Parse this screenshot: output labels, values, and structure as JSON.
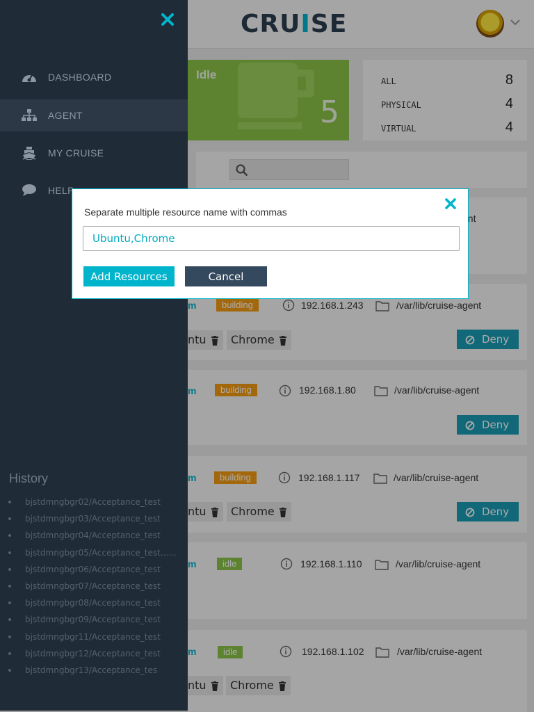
{
  "header": {
    "logo_text_a": "CRU",
    "logo_text_i": "I",
    "logo_text_b": "SE"
  },
  "status_card": {
    "label": "Idle",
    "count": "5",
    "color": "#8bc34a"
  },
  "counts": [
    {
      "label": "ALL",
      "value": "8"
    },
    {
      "label": "PHYSICAL",
      "value": "4"
    },
    {
      "label": "VIRTUAL",
      "value": "4"
    }
  ],
  "sidebar": {
    "items": [
      {
        "label": "DASHBOARD",
        "icon": "dashboard-icon"
      },
      {
        "label": "AGENT",
        "icon": "sitemap-icon",
        "active": true
      },
      {
        "label": "MY CRUISE",
        "icon": "ship-icon"
      },
      {
        "label": "HELP",
        "icon": "comment-icon"
      }
    ],
    "history_title": "History",
    "history": [
      "bjstdmngbgr02/Acceptance_test",
      "bjstdmngbgr03/Acceptance_test",
      "bjstdmngbgr04/Acceptance_test",
      "bjstdmngbgr05/Acceptance_test......",
      "bjstdmngbgr06/Acceptance_test",
      "bjstdmngbgr07/Acceptance_test",
      "bjstdmngbgr08/Acceptance_test",
      "bjstdmngbgr09/Acceptance_test",
      "bjstdmngbgr11/Acceptance_test",
      "bjstdmngbgr12/Acceptance_test",
      "bjstdmngbgr13/Acceptance_tes"
    ]
  },
  "agents": [
    {
      "name_suffix": "m",
      "status": "building",
      "ip": "192.168.1.243",
      "path": "/var/lib/cruise-agent",
      "tags": [
        "ntu",
        "Chrome"
      ],
      "deny_label": "Deny"
    },
    {
      "name_suffix": "m",
      "status": "building",
      "ip": "192.168.1.80",
      "path": "/var/lib/cruise-agent",
      "tags": [],
      "deny_label": "Deny"
    },
    {
      "name_suffix": "m",
      "status": "building",
      "ip": "192.168.1.117",
      "path": "/var/lib/cruise-agent",
      "tags": [
        "ntu",
        "Chrome"
      ],
      "deny_label": "Deny"
    },
    {
      "name_suffix": "m",
      "status": "idle",
      "ip": "192.168.1.110",
      "path": "/var/lib/cruise-agent",
      "tags": [],
      "deny_label": ""
    },
    {
      "name_suffix": "m",
      "status": "idle",
      "ip": "192.168.1.102",
      "path": "/var/lib/cruise-agent",
      "tags": [
        "ntu",
        "Chrome"
      ],
      "deny_label": ""
    }
  ],
  "partial_text": {
    "agent_top_path": "ent"
  },
  "dialog": {
    "label": "Separate multiple resource name with commas",
    "input_value": "Ubuntu,Chrome",
    "add_label": "Add Resources",
    "cancel_label": "Cancel"
  },
  "colors": {
    "accent": "#00b4cc",
    "sidebar": "#202b38",
    "building": "#f39c12",
    "idle": "#8bc34a",
    "deny": "#1a9bb3",
    "cancel": "#34495e"
  }
}
